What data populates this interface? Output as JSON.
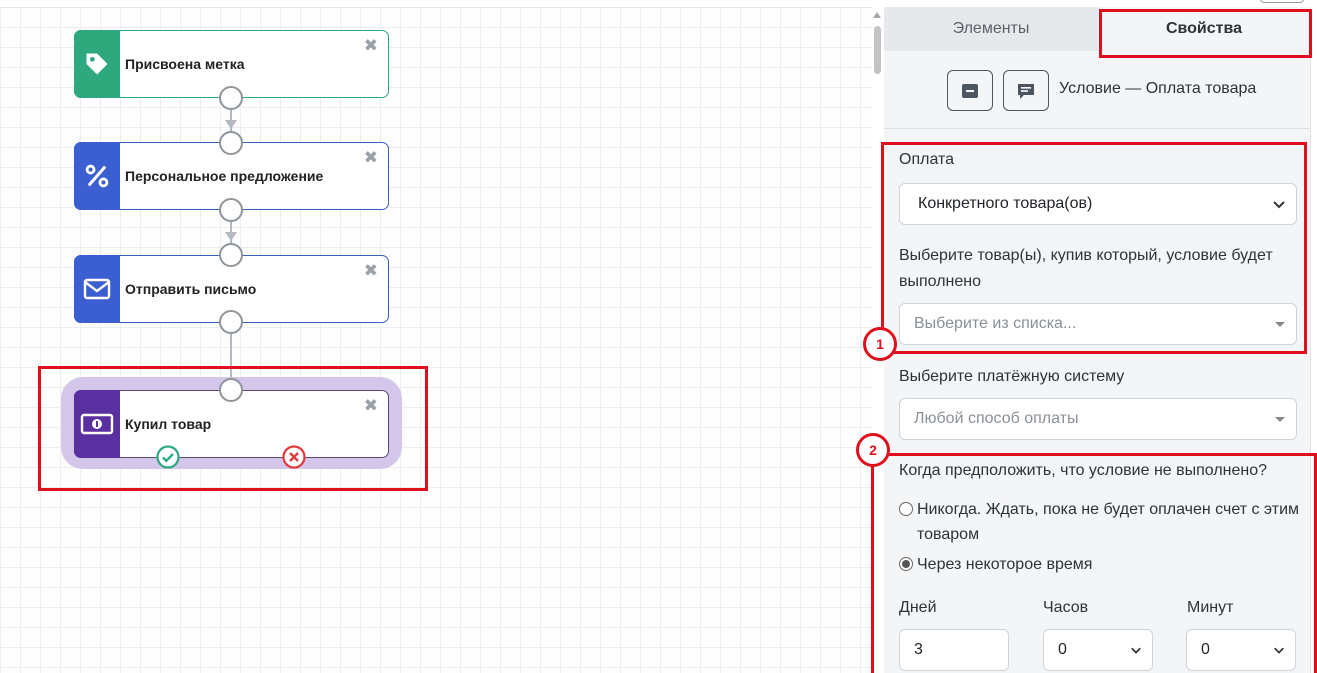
{
  "flow": {
    "nodes": [
      {
        "title": "Присвоена метка",
        "icon": "tag-icon",
        "color": "#2ea97e"
      },
      {
        "title": "Персональное предложение",
        "icon": "percent-icon",
        "color": "#3b5fd0"
      },
      {
        "title": "Отправить письмо",
        "icon": "envelope-icon",
        "color": "#3b5fd0"
      },
      {
        "title": "Купил товар",
        "icon": "money-icon",
        "color": "#5a2fa0"
      }
    ],
    "close_symbol": "✖"
  },
  "annotations": {
    "badge1": "1",
    "badge2": "2"
  },
  "panel": {
    "tabs": {
      "elements": "Элементы",
      "properties": "Свойства"
    },
    "condition_title": "Условие — Оплата товара",
    "payment_label": "Оплата",
    "payment_value": "Конкретного товара(ов)",
    "products_label": "Выберите товар(ы), купив который, условие будет выполнено",
    "products_placeholder": "Выберите из списка...",
    "system_label": "Выберите платёжную систему",
    "system_placeholder": "Любой способ оплаты",
    "when_label": "Когда предположить, что условие не выполнено?",
    "radio_never": "Никогда. Ждать, пока не будет оплачен счет с этим товаром",
    "radio_after": "Через некоторое время",
    "days_label": "Дней",
    "hours_label": "Часов",
    "minutes_label": "Минут",
    "days_value": "3",
    "hours_value": "0",
    "minutes_value": "0"
  },
  "colors": {
    "highlight": "#e00f1e",
    "selection": "#d4c5ea",
    "success": "#2ea97e",
    "danger": "#e03a3a"
  }
}
